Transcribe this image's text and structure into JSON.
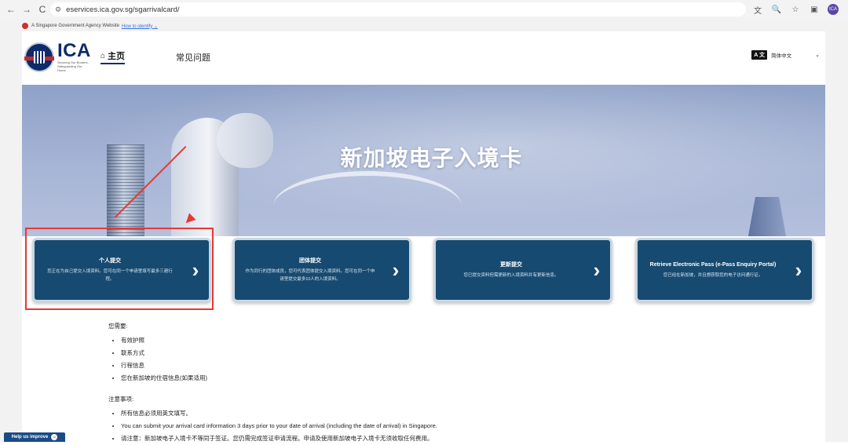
{
  "browser": {
    "back_icon": "←",
    "forward_icon": "→",
    "reload_icon": "C",
    "site_icon": "⚙",
    "url": "eservices.ica.gov.sg/sgarrivalcard/",
    "translate_icon": "文",
    "zoom_icon": "🔍",
    "star_icon": "☆",
    "panel_icon": "▣",
    "profile_initials": "ICA"
  },
  "gov_banner": {
    "text": "A Singapore Government Agency Website",
    "link": "How to identify ⌄"
  },
  "header": {
    "logo_text": "ICA",
    "logo_tagline": "Securing Our Borders, Safeguarding Our Home",
    "nav_home_icon": "⌂",
    "nav_home": "主页",
    "nav_faq": "常见问题",
    "lang_icon_label": "A 文",
    "lang_selected": "简体中文",
    "lang_caret": "⌄"
  },
  "hero": {
    "title": "新加坡电子入境卡"
  },
  "cards": [
    {
      "title": "个人提交",
      "desc": "您正在为自己提交入境资料。您可在同一个申请里填写最多三趟行程。",
      "chevron": "›"
    },
    {
      "title": "团体提交",
      "desc": "作为同行的团体成员，您可代表团体提交入境资料。您可在同一个申请里提交最多10人的入境资料。",
      "chevron": "›"
    },
    {
      "title": "更新提交",
      "desc": "您已提交资料但需更新的入境资料并有更新信息。",
      "chevron": "›"
    },
    {
      "title": "Retrieve Electronic Pass (e-Pass Enquiry Portal)",
      "desc": "您已经在新加坡，并且想获取您的电子访问通行证。",
      "chevron": "›"
    }
  ],
  "requirements": {
    "heading": "您需要:",
    "items": [
      "有效护照",
      "联系方式",
      "行程信息",
      "您在新加坡的住宿信息(如果适用)"
    ]
  },
  "notes": {
    "heading": "注意事项:",
    "items": [
      "所有信息必须用英文填写。",
      "You can submit your arrival card information 3 days prior to your date of arrival (including the date of arrival) in Singapore.",
      "请注意：新加坡电子入境卡不等同于签证。您仍需完成签证申请流程。申请及使用新加坡电子入境卡无须收取任何费用。"
    ]
  },
  "feedback": {
    "label": "Help us improve",
    "icon": "☺"
  }
}
